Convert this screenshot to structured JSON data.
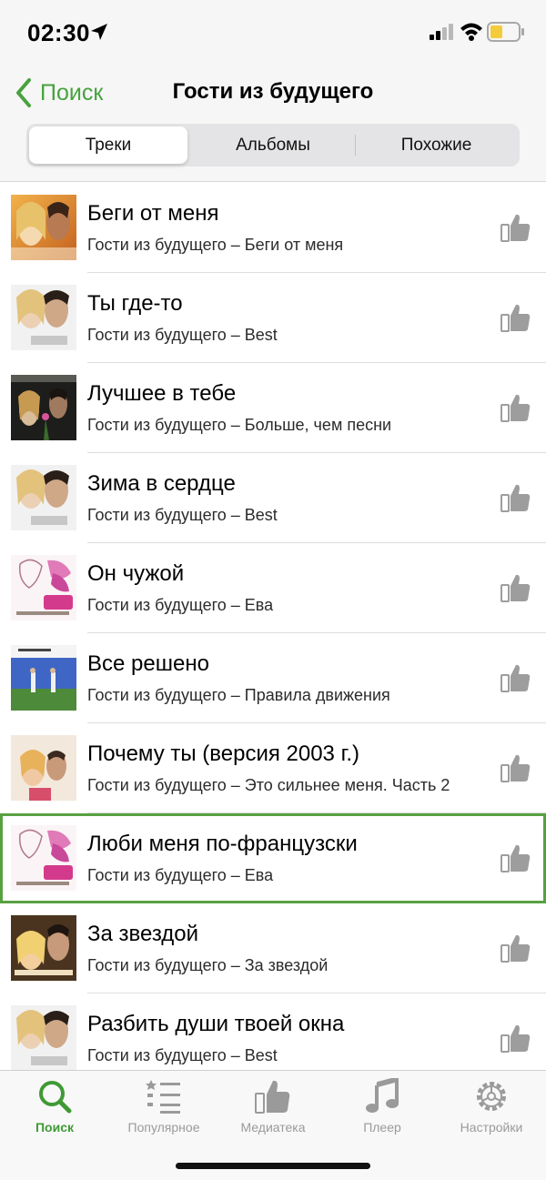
{
  "status": {
    "time": "02:30"
  },
  "nav": {
    "back_label": "Поиск",
    "title": "Гости из будущего"
  },
  "segments": [
    "Треки",
    "Альбомы",
    "Похожие"
  ],
  "tracks": [
    {
      "title": "Беги от меня",
      "subtitle": "Гости из будущего – Беги от меня"
    },
    {
      "title": "Ты где-то",
      "subtitle": "Гости из будущего – Best"
    },
    {
      "title": "Лучшее в тебе",
      "subtitle": "Гости из будущего – Больше, чем песни"
    },
    {
      "title": "Зима в сердце",
      "subtitle": "Гости из будущего – Best"
    },
    {
      "title": "Он чужой",
      "subtitle": "Гости из будущего – Ева"
    },
    {
      "title": "Все решено",
      "subtitle": "Гости из будущего – Правила движения"
    },
    {
      "title": "Почему ты (версия 2003 г.)",
      "subtitle": "Гости из будущего – Это сильнее меня. Часть 2"
    },
    {
      "title": "Люби меня по-французски",
      "subtitle": "Гости из будущего – Ева"
    },
    {
      "title": "За звездой",
      "subtitle": "Гости из будущего – За звездой"
    },
    {
      "title": "Разбить души твоей окна",
      "subtitle": "Гости из будущего – Best"
    }
  ],
  "tabs": [
    {
      "label": "Поиск",
      "icon": "search-icon"
    },
    {
      "label": "Популярное",
      "icon": "list-icon"
    },
    {
      "label": "Медиатека",
      "icon": "thumbs-up-icon"
    },
    {
      "label": "Плеер",
      "icon": "music-note-icon"
    },
    {
      "label": "Настройки",
      "icon": "gear-icon"
    }
  ],
  "colors": {
    "accent": "#48a23f",
    "selected_border": "#58a141",
    "inactive": "#9a9a9a"
  }
}
